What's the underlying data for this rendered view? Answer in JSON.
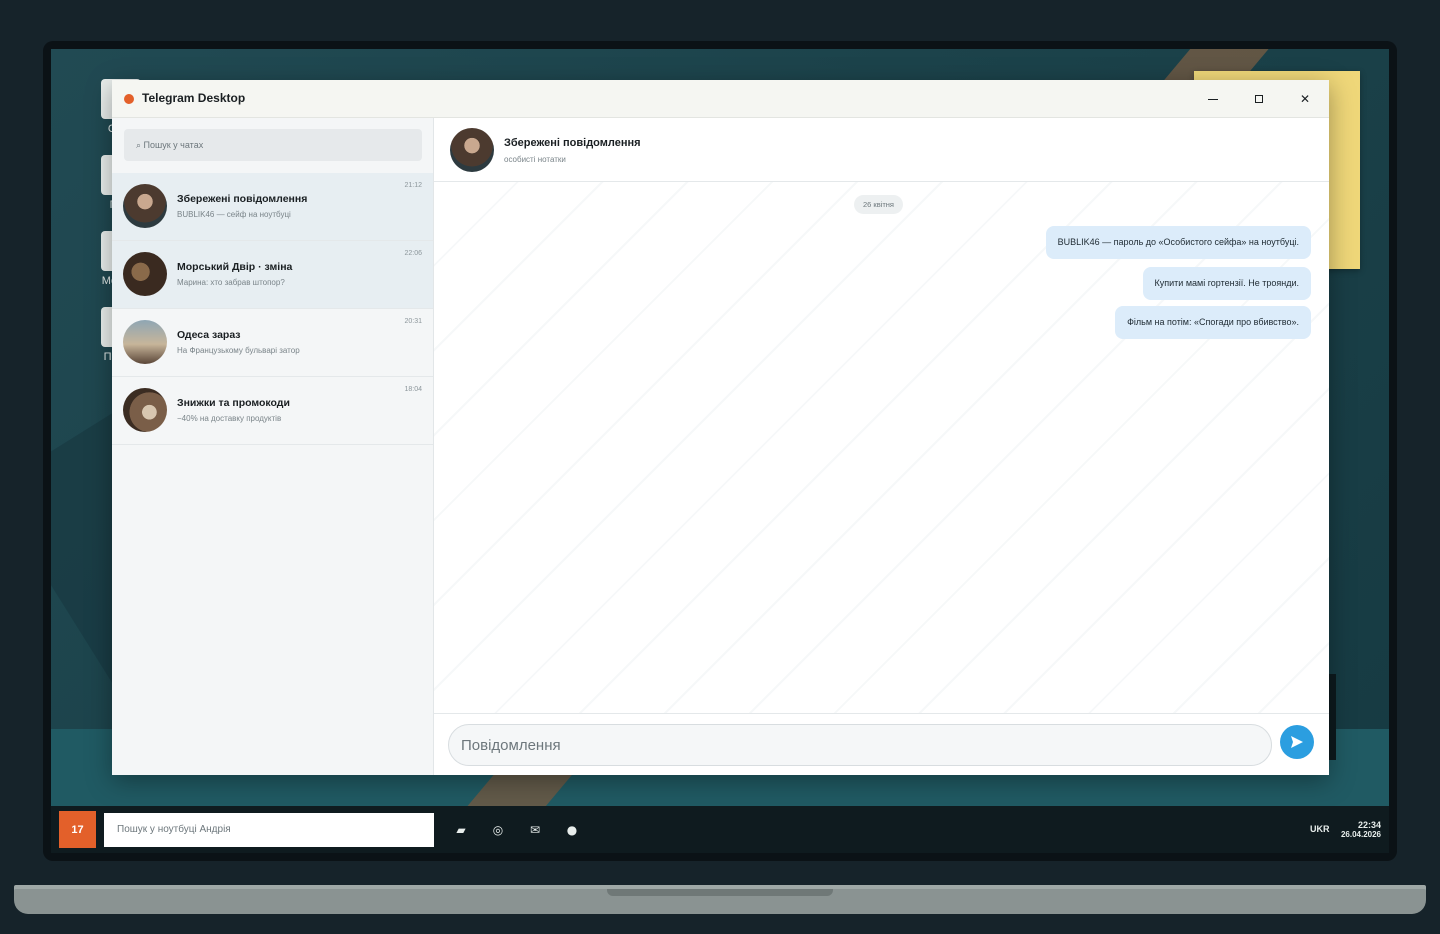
{
  "window": {
    "title": "Telegram Desktop",
    "accent_color": "#e3602a"
  },
  "desktop_icons": [
    {
      "label": "Спра",
      "icon": "document-icon"
    },
    {
      "label": "Пош",
      "icon": "mail-icon"
    },
    {
      "label": "Мессен",
      "icon": "dot-icon"
    },
    {
      "label": "Провід",
      "icon": "folder-icon"
    }
  ],
  "sidebar": {
    "search_placeholder": "⌕ Пошук у чатах",
    "chats": [
      {
        "name": "Збережені повідомлення",
        "preview": "BUBLIK46 — сейф на ноутбуці",
        "time": "21:12",
        "active": true
      },
      {
        "name": "Морський Двір · зміна",
        "preview": "Марина: хто забрав штопор?",
        "time": "22:06",
        "active": false
      },
      {
        "name": "Одеса зараз",
        "preview": "На Французькому бульварі затор",
        "time": "20:31",
        "active": false
      },
      {
        "name": "Знижки та промокоди",
        "preview": "−40% на доставку продуктів",
        "time": "18:04",
        "active": false
      }
    ]
  },
  "chat": {
    "header_name": "Збережені повідомлення",
    "header_sub": "особисті нотатки",
    "date_chip": "26 квітня",
    "messages": [
      "BUBLIK46 — пароль до «Особистого сейфа» на ноутбуці.",
      "Купити мамі гортензії. Не троянди.",
      "Фільм на потім: «Спогади про вбивство»."
    ],
    "composer_placeholder": "Повідомлення",
    "bubble_color": "#dcecfa",
    "send_color": "#2b9ee0"
  },
  "taskbar": {
    "start_label": "17",
    "search_placeholder": "Пошук у ноутбуці Андрія",
    "language": "UKR",
    "time": "22:34",
    "date": "26.04.2026"
  }
}
